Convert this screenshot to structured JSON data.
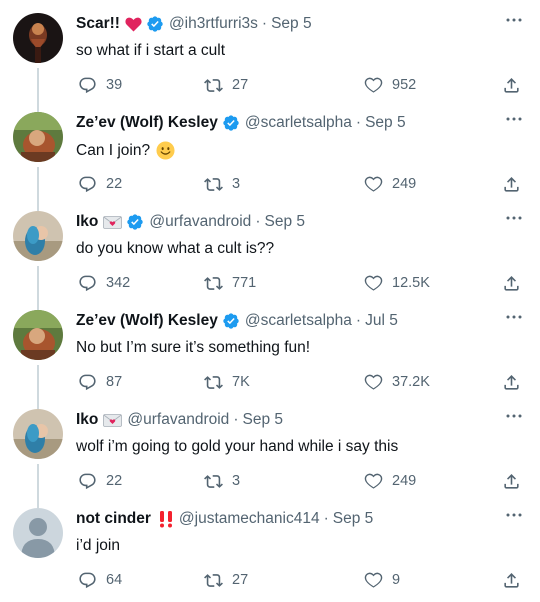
{
  "colors": {
    "verified": "#1d9bf0",
    "heart": "#e0245e",
    "secondary": "#536471",
    "thread": "#cfd9de",
    "exclaim": "#f4212e"
  },
  "tweets": [
    {
      "name": "Scar!!",
      "badge_emoji": "heart",
      "verified": true,
      "handle": "@ih3rtfurri3s",
      "date": "Sep 5",
      "text": "so what if i start a cult",
      "replies": "39",
      "retweets": "27",
      "likes": "952",
      "avatar": "avatar-scar"
    },
    {
      "name": "Ze’ev (Wolf) Kesley",
      "verified": true,
      "handle": "@scarletsalpha",
      "date": "Sep 5",
      "text": "Can I join?",
      "text_emoji": "slightly-smiling-face",
      "replies": "22",
      "retweets": "3",
      "likes": "249",
      "avatar": "avatar-wolf"
    },
    {
      "name": "Iko",
      "badge_emoji": "love-letter",
      "verified": true,
      "handle": "@urfavandroid",
      "date": "Sep 5",
      "text": "do you know what a cult is??",
      "replies": "342",
      "retweets": "771",
      "likes": "12.5K",
      "avatar": "avatar-iko"
    },
    {
      "name": "Ze’ev (Wolf) Kesley",
      "verified": true,
      "handle": "@scarletsalpha",
      "date": "Jul 5",
      "text": "No but I’m sure it’s something fun!",
      "replies": "87",
      "retweets": "7K",
      "likes": "37.2K",
      "avatar": "avatar-wolf"
    },
    {
      "name": "Iko",
      "badge_emoji": "love-letter",
      "verified": false,
      "handle": "@urfavandroid",
      "date": "Sep 5",
      "text": "wolf i’m going to gold your hand while i say this",
      "replies": "22",
      "retweets": "3",
      "likes": "249",
      "avatar": "avatar-iko"
    },
    {
      "name": "not cinder",
      "badge_emoji": "double-exclamation",
      "verified": false,
      "handle": "@justamechanic414",
      "date": "Sep 5",
      "text": "i’d join",
      "replies": "64",
      "retweets": "27",
      "likes": "9",
      "avatar": "avatar-default"
    }
  ],
  "icons": {
    "reply": "reply-icon",
    "retweet": "retweet-icon",
    "like": "like-icon",
    "share": "share-icon",
    "more": "more-icon",
    "verified": "verified-badge-icon"
  },
  "separator": "·"
}
